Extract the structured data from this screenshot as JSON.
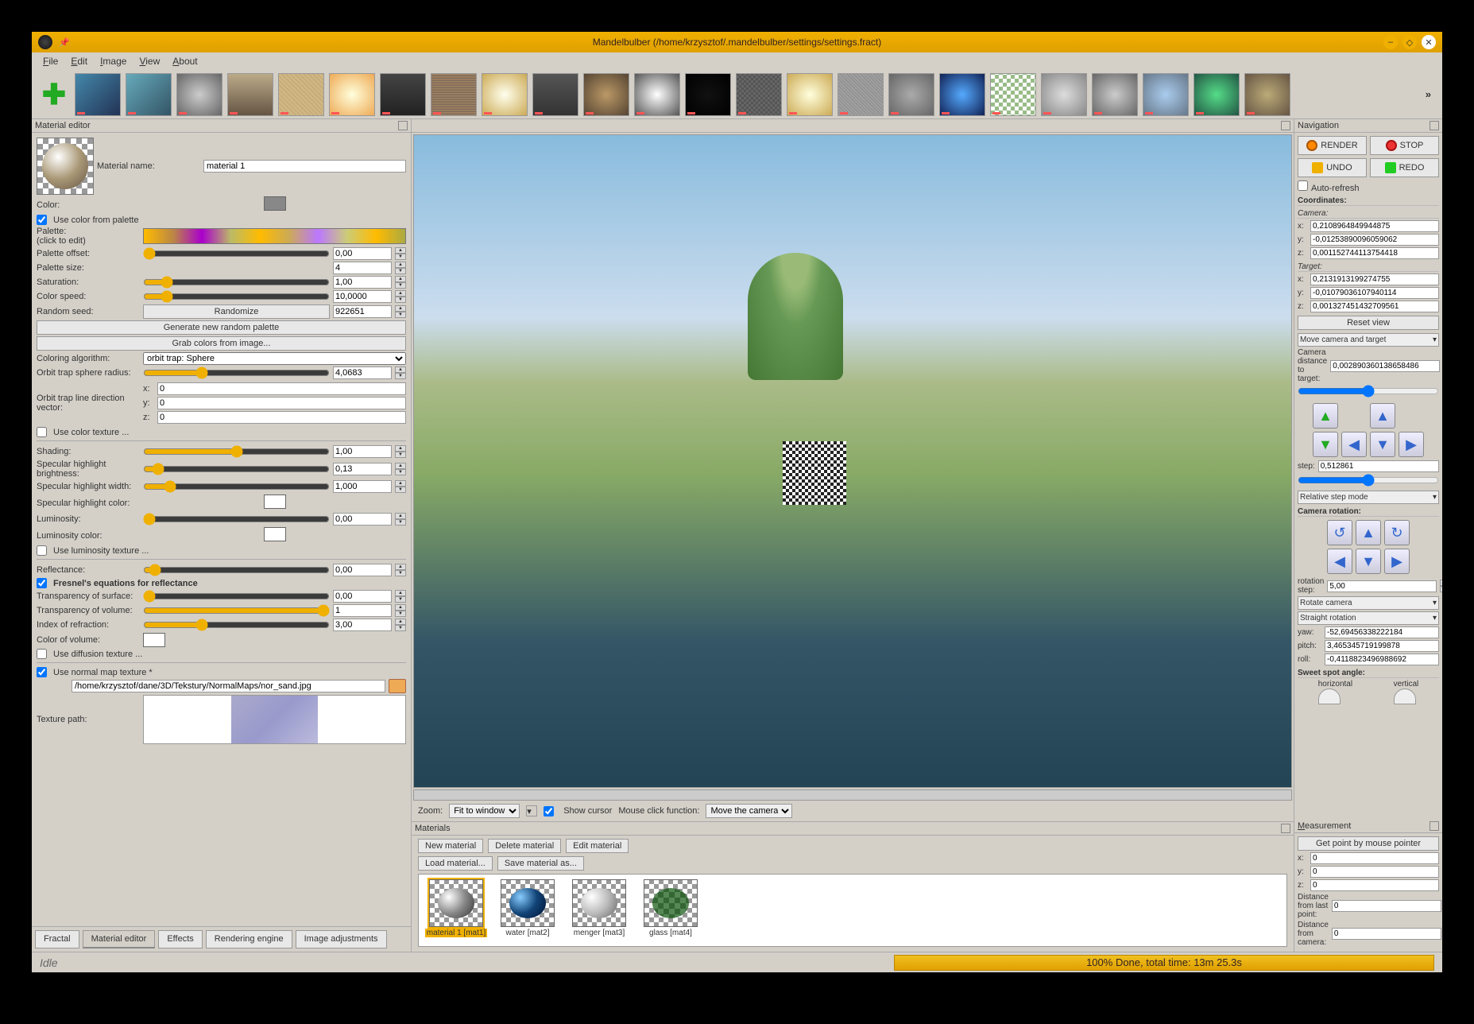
{
  "title": "Mandelbulber (/home/krzysztof/.mandelbulber/settings/settings.fract)",
  "menu": {
    "file": "File",
    "edit": "Edit",
    "image": "Image",
    "view": "View",
    "about": "About"
  },
  "docks": {
    "material_editor": "Material editor",
    "navigation": "Navigation",
    "materials": "Materials",
    "measurement": "Measurement"
  },
  "material": {
    "name_label": "Material name:",
    "name_value": "material 1",
    "color_label": "Color:",
    "use_color_palette": "Use color from palette",
    "palette_label": "Palette:",
    "palette_hint": "(click to edit)",
    "palette_offset": "Palette offset:",
    "palette_offset_v": "0,00",
    "palette_size": "Palette size:",
    "palette_size_v": "4",
    "saturation": "Saturation:",
    "saturation_v": "1,00",
    "color_speed": "Color speed:",
    "color_speed_v": "10,0000",
    "random_seed": "Random seed:",
    "random_seed_v": "922651",
    "randomize": "Randomize",
    "gen_palette": "Generate new random palette",
    "grab_colors": "Grab colors from image...",
    "color_algo": "Coloring algorithm:",
    "color_algo_v": "orbit trap: Sphere",
    "orbit_trap_sphere": "Orbit trap sphere radius:",
    "orbit_trap_sphere_v": "4,0683",
    "orbit_trap_line": "Orbit trap line direction vector:",
    "dir_x": "x:",
    "dir_x_v": "0",
    "dir_y": "y:",
    "dir_y_v": "0",
    "dir_z": "z:",
    "dir_z_v": "0",
    "use_color_texture": "Use color texture ...",
    "shading": "Shading:",
    "shading_v": "1,00",
    "spec_bright": "Specular highlight brightness:",
    "spec_bright_v": "0,13",
    "spec_width": "Specular highlight width:",
    "spec_width_v": "1,000",
    "spec_color": "Specular highlight color:",
    "luminosity": "Luminosity:",
    "luminosity_v": "0,00",
    "luminosity_color": "Luminosity color:",
    "use_lum_texture": "Use luminosity texture ...",
    "reflectance": "Reflectance:",
    "reflectance_v": "0,00",
    "fresnel": "Fresnel's equations for reflectance",
    "transp_surface": "Transparency of surface:",
    "transp_surface_v": "0,00",
    "transp_volume": "Transparency of volume:",
    "transp_volume_v": "1",
    "ior": "Index of refraction:",
    "ior_v": "3,00",
    "vol_color": "Color of volume:",
    "use_diffusion": "Use diffusion texture ...",
    "use_normal": "Use normal map texture *",
    "normal_path": "/home/krzysztof/dane/3D/Tekstury/NormalMaps/nor_sand.jpg",
    "texture_path": "Texture path:"
  },
  "tabs": {
    "fractal": "Fractal",
    "material": "Material editor",
    "effects": "Effects",
    "render": "Rendering engine",
    "image": "Image adjustments"
  },
  "zoom": {
    "label": "Zoom:",
    "value": "Fit to window",
    "show_cursor": "Show cursor",
    "click_fn": "Mouse click function:",
    "click_v": "Move the camera"
  },
  "materials": {
    "new": "New material",
    "delete": "Delete material",
    "edit": "Edit material",
    "load": "Load material...",
    "save": "Save material as...",
    "items": [
      {
        "label": "material 1 [mat1]"
      },
      {
        "label": "water [mat2]"
      },
      {
        "label": "menger [mat3]"
      },
      {
        "label": "glass [mat4]"
      }
    ]
  },
  "nav": {
    "render": "RENDER",
    "stop": "STOP",
    "undo": "UNDO",
    "redo": "REDO",
    "auto_refresh": "Auto-refresh",
    "coordinates": "Coordinates:",
    "camera": "Camera:",
    "cx": "0,2108964849944875",
    "cy": "-0,01253890096059062",
    "cz": "0,001152744113754418",
    "target": "Target:",
    "tx": "0,2131913199274755",
    "ty": "-0,01079036107940114",
    "tz": "0,001327451432709561",
    "reset_view": "Reset view",
    "move_mode": "Move camera and target",
    "cam_dist": "Camera distance to target:",
    "cam_dist_v": "0,002890360138658486",
    "step": "step:",
    "step_v": "0,512861",
    "step_mode": "Relative step mode",
    "cam_rot": "Camera rotation:",
    "rot_step": "rotation step:",
    "rot_step_v": "5,00",
    "rot_cam": "Rotate camera",
    "straight_rot": "Straight rotation",
    "yaw": "yaw:",
    "yaw_v": "-52,69456338222184",
    "pitch": "pitch:",
    "pitch_v": "3,465345719199878",
    "roll": "roll:",
    "roll_v": "-0,4118823496988692",
    "sweet_spot": "Sweet spot angle:",
    "horizontal": "horizontal",
    "vertical": "vertical"
  },
  "measure": {
    "get_point": "Get point by mouse pointer",
    "x": "x:",
    "xv": "0",
    "y": "y:",
    "yv": "0",
    "z": "z:",
    "zv": "0",
    "last_point": "Distance from last point:",
    "last_point_v": "0",
    "camera": "Distance from camera:",
    "camera_v": "0"
  },
  "status": {
    "idle": "Idle",
    "progress": "100% Done, total time: 13m 25.3s"
  }
}
